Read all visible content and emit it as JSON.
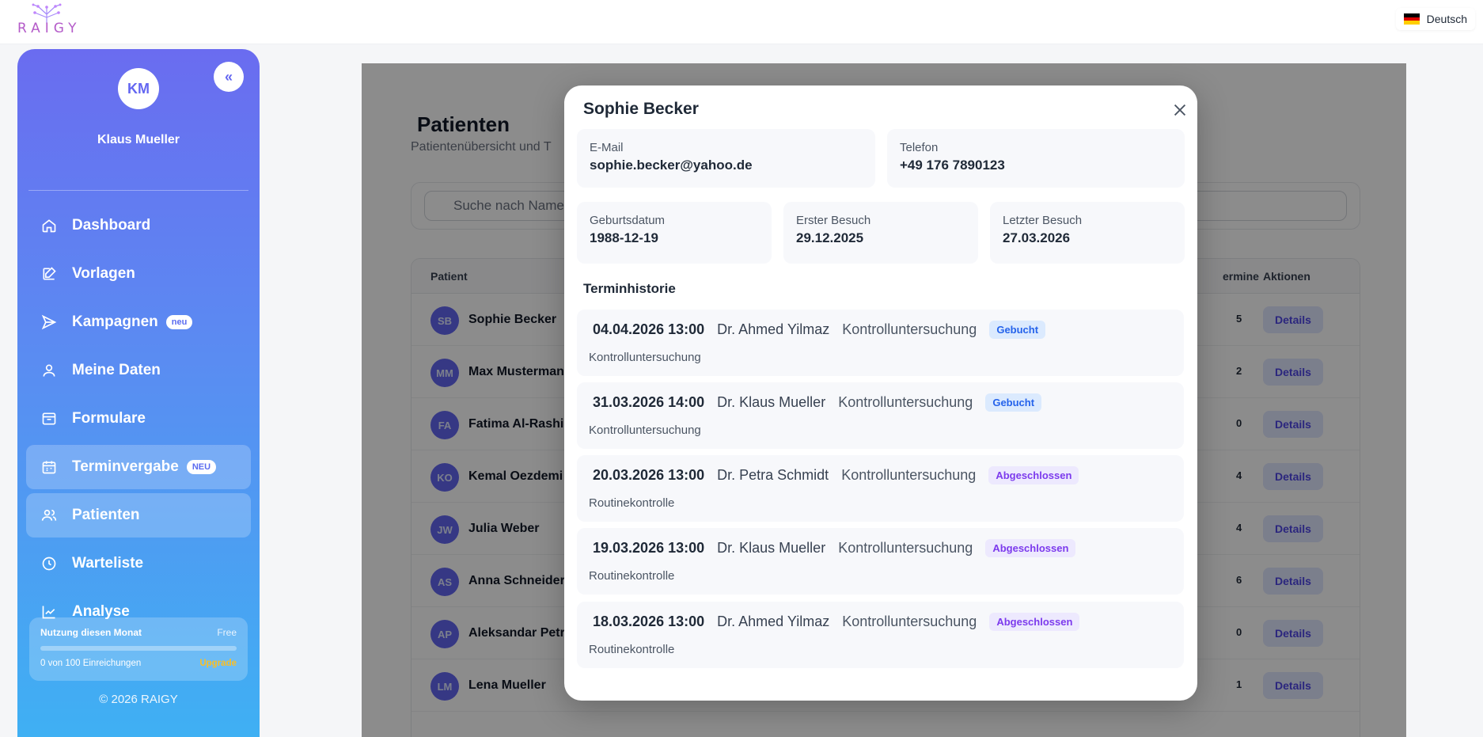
{
  "app": {
    "logo_text": "RAIGY",
    "language": "Deutsch"
  },
  "sidebar": {
    "avatar_initials": "KM",
    "user_name": "Klaus Mueller",
    "collapse_icon": "«",
    "items": [
      {
        "label": "Dashboard",
        "icon": "home-icon"
      },
      {
        "label": "Vorlagen",
        "icon": "edit-icon"
      },
      {
        "label": "Kampagnen",
        "icon": "send-icon",
        "badge": "neu"
      },
      {
        "label": "Meine Daten",
        "icon": "user-icon"
      },
      {
        "label": "Formulare",
        "icon": "inbox-icon"
      },
      {
        "label": "Terminvergabe",
        "icon": "calendar-icon",
        "badge": "NEU"
      },
      {
        "label": "Patienten",
        "icon": "users-icon"
      },
      {
        "label": "Warteliste",
        "icon": "clock-icon"
      },
      {
        "label": "Analyse",
        "icon": "chart-icon"
      }
    ],
    "usage": {
      "title": "Nutzung diesen Monat",
      "plan": "Free",
      "count_text": "0 von 100 Einreichungen",
      "upgrade_label": "Upgrade",
      "progress": 0
    },
    "copyright": "© 2026 RAIGY"
  },
  "main": {
    "title": "Patienten",
    "subtitle": "Patientenübersicht und T",
    "search_placeholder": "Suche nach Name",
    "table": {
      "headers": {
        "patient": "Patient",
        "termine": "ermine",
        "aktionen": "Aktionen"
      },
      "rows": [
        {
          "initials": "SB",
          "name": "Sophie Becker",
          "count": "5",
          "action": "Details"
        },
        {
          "initials": "MM",
          "name": "Max Musterman",
          "count": "2",
          "action": "Details"
        },
        {
          "initials": "FA",
          "name": "Fatima Al-Rashi",
          "count": "0",
          "action": "Details"
        },
        {
          "initials": "KO",
          "name": "Kemal Oezdemi",
          "count": "4",
          "action": "Details"
        },
        {
          "initials": "JW",
          "name": "Julia Weber",
          "count": "4",
          "action": "Details"
        },
        {
          "initials": "AS",
          "name": "Anna Schneider",
          "count": "6",
          "action": "Details"
        },
        {
          "initials": "AP",
          "name": "Aleksandar Petr",
          "count": "0",
          "action": "Details"
        },
        {
          "initials": "LM",
          "name": "Lena Mueller",
          "count": "1",
          "action": "Details"
        }
      ]
    }
  },
  "modal": {
    "title": "Sophie Becker",
    "email_label": "E-Mail",
    "email": "sophie.becker@yahoo.de",
    "phone_label": "Telefon",
    "phone": "+49 176 7890123",
    "birth_label": "Geburtsdatum",
    "birth": "1988-12-19",
    "first_label": "Erster Besuch",
    "first": "29.12.2025",
    "last_label": "Letzter Besuch",
    "last": "27.03.2026",
    "history_title": "Terminhistorie",
    "appointments": [
      {
        "datetime": "04.04.2026 13:00",
        "doctor": "Dr. Ahmed Yilmaz",
        "type": "Kontrolluntersuchung",
        "status": "Gebucht",
        "note": "Kontrolluntersuchung"
      },
      {
        "datetime": "31.03.2026 14:00",
        "doctor": "Dr. Klaus Mueller",
        "type": "Kontrolluntersuchung",
        "status": "Gebucht",
        "note": "Kontrolluntersuchung"
      },
      {
        "datetime": "20.03.2026 13:00",
        "doctor": "Dr. Petra Schmidt",
        "type": "Kontrolluntersuchung",
        "status": "Abgeschlossen",
        "note": "Routinekontrolle"
      },
      {
        "datetime": "19.03.2026 13:00",
        "doctor": "Dr. Klaus Mueller",
        "type": "Kontrolluntersuchung",
        "status": "Abgeschlossen",
        "note": "Routinekontrolle"
      },
      {
        "datetime": "18.03.2026 13:00",
        "doctor": "Dr. Ahmed Yilmaz",
        "type": "Kontrolluntersuchung",
        "status": "Abgeschlossen",
        "note": "Routinekontrolle"
      }
    ]
  }
}
